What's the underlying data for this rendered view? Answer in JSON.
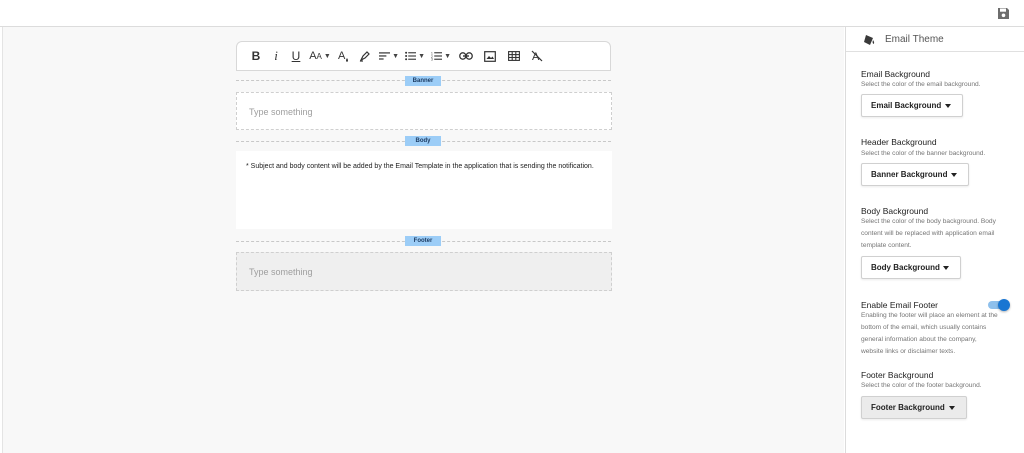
{
  "topbar": {
    "save_icon": "floppy-disk-icon"
  },
  "toolbar": {
    "buttons": [
      "bold",
      "italic",
      "underline",
      "font-size",
      "font-color",
      "highlight",
      "align",
      "bullet-list",
      "numbered-list",
      "link",
      "image",
      "table",
      "clear-format"
    ]
  },
  "canvas": {
    "banner_tag": "Banner",
    "banner_placeholder": "Type something",
    "body_tag": "Body",
    "body_note": "* Subject and body content will be added by the Email Template in the application that is sending the notification.",
    "footer_tag": "Footer",
    "footer_placeholder": "Type something"
  },
  "panel": {
    "title": "Email Theme",
    "email_bg": {
      "title": "Email Background",
      "desc": "Select the color of the email background.",
      "button": "Email Background"
    },
    "header_bg": {
      "title": "Header Background",
      "desc": "Select the color of the banner background.",
      "button": "Banner Background"
    },
    "body_bg": {
      "title": "Body Background",
      "desc_lines": [
        "Select the color of the body background. Body",
        "content will be replaced with application email",
        "template content."
      ],
      "button": "Body Background"
    },
    "footer_toggle": {
      "title": "Enable Email Footer",
      "enabled": true,
      "desc_lines": [
        "Enabling the footer will place an element at the",
        "bottom of the email, which usually contains",
        "general information about the company,",
        "website links or disclaimer texts."
      ]
    },
    "footer_bg": {
      "title": "Footer Background",
      "desc": "Select the color of the footer background.",
      "button": "Footer Background"
    }
  },
  "colors": {
    "accent": "#1976d2",
    "tag_bg": "#9ccdf7",
    "canvas_bg": "#f8f8f8"
  }
}
